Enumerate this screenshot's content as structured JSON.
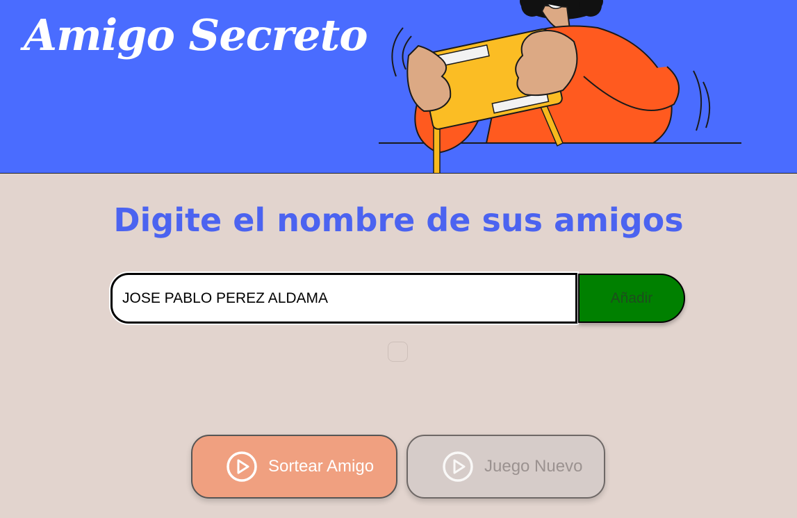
{
  "header": {
    "title": "Amigo Secreto",
    "background_color": "#4a6cff"
  },
  "main": {
    "heading": "Digite el nombre de sus amigos",
    "heading_color": "#4b63f0",
    "background_color": "#e2d4ce"
  },
  "friend_input": {
    "value": "JOSE PABLO PEREZ ALDAMA",
    "placeholder": ""
  },
  "add_button": {
    "label": "Añadir",
    "color": "#008000"
  },
  "actions": {
    "draw": {
      "label": "Sortear Amigo",
      "icon": "play-circle-icon",
      "color": "#f0a080"
    },
    "new_game": {
      "label": "Juego Nuevo",
      "icon": "play-circle-icon",
      "color": "#d6ccc9"
    }
  }
}
